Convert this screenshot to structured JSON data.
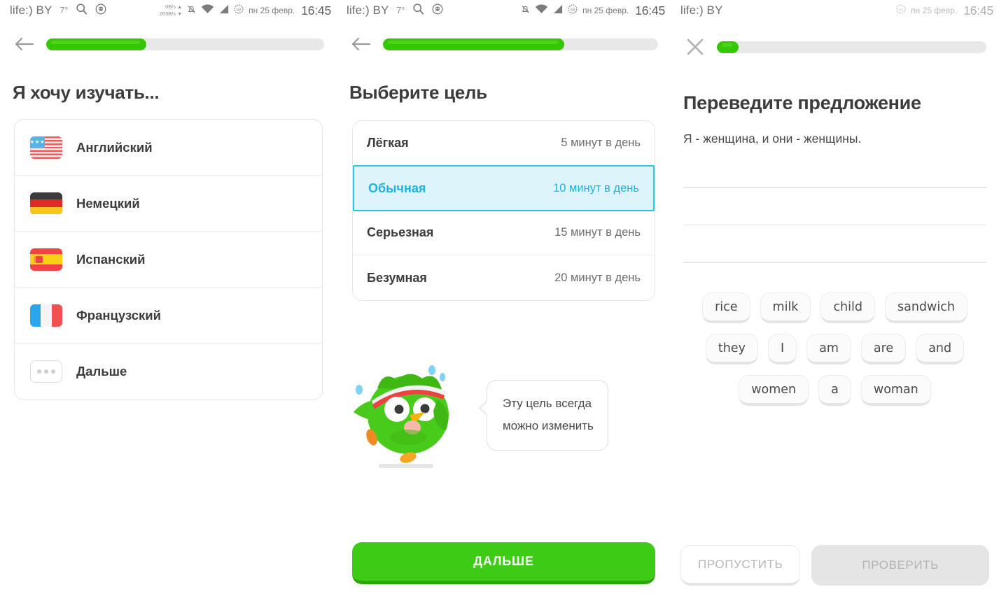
{
  "statusbars": [
    {
      "carrier": "life:) BY",
      "temperature": "7°",
      "icons": [
        "search-icon",
        "shield-icon",
        "notification-off-icon",
        "wifi-icon",
        "signal-icon",
        "battery-icon"
      ],
      "net_up": "0B/s",
      "net_down": "203B/s",
      "date": "пн 25 февр.",
      "time": "16:45"
    },
    {
      "carrier": "life:) BY",
      "temperature": "7°",
      "icons": [
        "search-icon",
        "shield-icon",
        "notification-off-icon",
        "wifi-icon",
        "signal-icon",
        "battery-icon"
      ],
      "net_up": "",
      "net_down": "",
      "date": "пн 25 февр.",
      "time": "16:45"
    },
    {
      "carrier": "life:) BY",
      "temperature": "",
      "icons": [
        "battery-icon"
      ],
      "net_up": "",
      "net_down": "",
      "date": "пн 25 февр.",
      "time": "16:45"
    }
  ],
  "colors": {
    "brand_green": "#35c800",
    "button_green": "#3dcb16",
    "button_green_shadow": "#2ea40c",
    "selection_cyan": "#2bc3e8",
    "selection_cyan_bg": "#ddf4fb",
    "text_dark": "#3c3c3c",
    "text_muted": "#6d6d6d",
    "track_grey": "#e8e8e8"
  },
  "screen1": {
    "nav_icon": "back-arrow-icon",
    "progress_percent": 36,
    "title": "Я хочу изучать...",
    "languages": [
      {
        "label": "Английский",
        "flag": "flag-us"
      },
      {
        "label": "Немецкий",
        "flag": "flag-de"
      },
      {
        "label": "Испанский",
        "flag": "flag-es"
      },
      {
        "label": "Французский",
        "flag": "flag-fr"
      },
      {
        "label": "Дальше",
        "flag": "more-icon"
      }
    ]
  },
  "screen2": {
    "nav_icon": "back-arrow-icon",
    "progress_percent": 66,
    "title": "Выберите цель",
    "goals": [
      {
        "name": "Лёгкая",
        "time": "5 минут в день",
        "selected": false
      },
      {
        "name": "Обычная",
        "time": "10 минут в день",
        "selected": true
      },
      {
        "name": "Серьезная",
        "time": "15 минут в день",
        "selected": false
      },
      {
        "name": "Безумная",
        "time": "20 минут в день",
        "selected": false
      }
    ],
    "mascot": "duo-owl-icon",
    "bubble_line1": "Эту цель всегда",
    "bubble_line2": "можно изменить",
    "next_button": "ДАЛЬШЕ"
  },
  "screen3": {
    "nav_icon": "close-icon",
    "progress_percent": 8,
    "title": "Переведите предложение",
    "sentence": "Я - женщина, и они - женщины.",
    "answer_lines": 3,
    "word_bank": [
      [
        "rice",
        "milk",
        "child",
        "sandwich"
      ],
      [
        "they",
        "I",
        "am",
        "are",
        "and"
      ],
      [
        "women",
        "a",
        "woman"
      ]
    ],
    "skip_button": "ПРОПУСТИТЬ",
    "check_button": "ПРОВЕРИТЬ"
  }
}
